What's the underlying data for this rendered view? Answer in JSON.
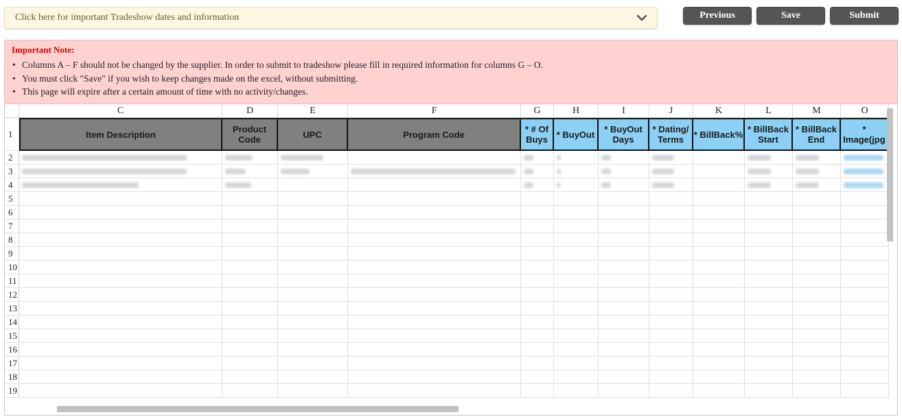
{
  "accordion": {
    "label": "Click here for important Tradeshow dates and information",
    "icon": "chevron-down-icon"
  },
  "toolbar": {
    "previous_label": "Previous",
    "save_label": "Save",
    "submit_label": "Submit"
  },
  "note": {
    "title": "Important Note:",
    "items": [
      "Columns A – F should not be changed by the supplier. In order to submit to tradeshow please fill in required information for columns G – O.",
      "You must click \"Save\" if you wish to keep changes made on the excel, without submitting.",
      "This page will expire after a certain amount of time with no activity/changes."
    ]
  },
  "sheet": {
    "column_letters": [
      "C",
      "D",
      "E",
      "F",
      "G",
      "H",
      "I",
      "J",
      "K",
      "L",
      "M",
      "O"
    ],
    "headers": [
      {
        "text": "Item Description",
        "style": "gray"
      },
      {
        "text": "Product Code",
        "style": "gray"
      },
      {
        "text": "UPC",
        "style": "gray"
      },
      {
        "text": "Program Code",
        "style": "gray"
      },
      {
        "text": "* # Of Buys",
        "style": "blue"
      },
      {
        "text": "* BuyOut",
        "style": "blue"
      },
      {
        "text": "* BuyOut Days",
        "style": "blue"
      },
      {
        "text": "* Dating/ Terms",
        "style": "blue"
      },
      {
        "text": "* BillBack%",
        "style": "blue"
      },
      {
        "text": "* BillBack Start",
        "style": "blue"
      },
      {
        "text": "* BillBack End",
        "style": "blue"
      },
      {
        "text": "* Image(jpg",
        "style": "blue"
      }
    ],
    "row_numbers": [
      "1",
      "2",
      "3",
      "4",
      "5",
      "6",
      "7",
      "8",
      "9",
      "10",
      "11",
      "12",
      "13",
      "14",
      "15",
      "16",
      "17",
      "18",
      "19"
    ]
  },
  "colors": {
    "gray_header": "#808080",
    "blue_header": "#8dd0f5",
    "note_bg": "#ffd2d2",
    "note_title": "#d40000",
    "button": "#555555"
  }
}
